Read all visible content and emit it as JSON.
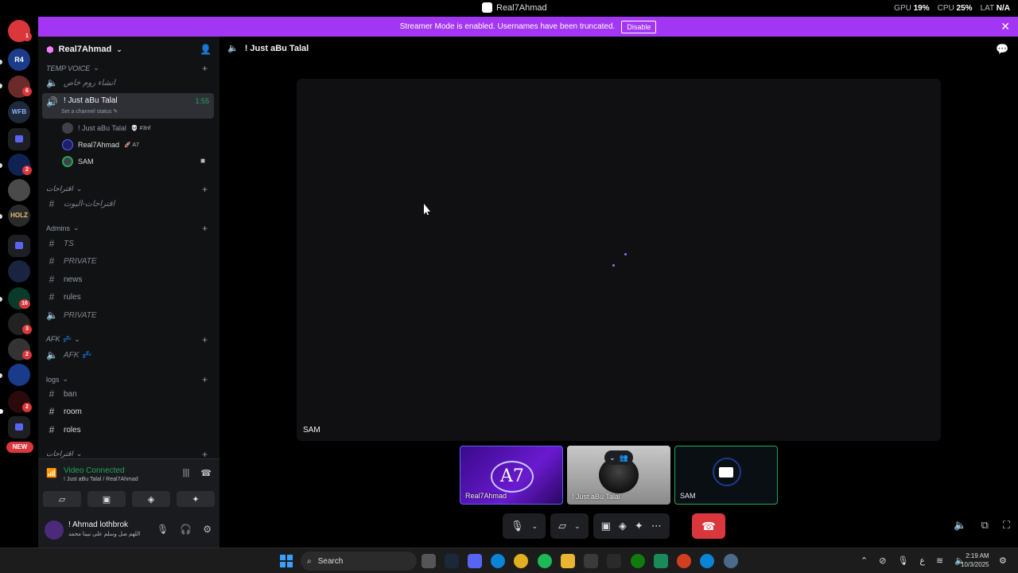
{
  "window": {
    "title": "Real7Ahmad"
  },
  "perf": {
    "gpu_label": "GPU",
    "gpu_value": "19%",
    "cpu_label": "CPU",
    "cpu_value": "25%",
    "lat_label": "LAT",
    "lat_value": "N/A"
  },
  "banner": {
    "text": "Streamer Mode is enabled. Usernames have been truncated.",
    "button": "Disable"
  },
  "rail": {
    "badges": [
      "1",
      "6",
      "2",
      "16",
      "3",
      "2",
      "2"
    ],
    "new_label": "NEW",
    "server_text": [
      "R4",
      "WFB",
      "HOLZ"
    ]
  },
  "server": {
    "name": "Real7Ahmad"
  },
  "sidebar": {
    "cat_temp": "TEMP VOICE",
    "ch_create_room": "انشاء روم خاص",
    "active_channel": {
      "name": "! Just aBu Talal",
      "timer": "1:55",
      "status": "Set a channel status"
    },
    "voice_users": [
      {
        "name": "! Just aBu Talal",
        "tag": "#3nf"
      },
      {
        "name": "Real7Ahmad",
        "tag": "A7"
      },
      {
        "name": "SAM",
        "tag": ""
      }
    ],
    "cat_suggest": "اقتراحات",
    "ch_suggest_bot": "اقتراحات-البوت",
    "cat_admins": "Admins",
    "ch_ts": "TS",
    "ch_private1": "PRIVATE",
    "ch_news": "news",
    "ch_rules": "rules",
    "ch_private2": "PRIVATE",
    "cat_afk": "AFK 💤",
    "ch_afk": "AFK 💤",
    "cat_logs": "logs",
    "ch_ban": "ban",
    "ch_room": "room",
    "ch_roles": "roles",
    "cat_suggest2": "اقتراحات"
  },
  "voice_panel": {
    "status": "Video Connected",
    "location": "! Just aBu Talal / Real7Ahmad"
  },
  "user_panel": {
    "name": "! Ahmad lothbrok",
    "status": "اللهم صل وسلم على نبينا محمد"
  },
  "main": {
    "channel_title": "! Just aBu Talal",
    "stage_label": "SAM",
    "tiles": [
      {
        "label": "Real7Ahmad",
        "logo": "A7"
      },
      {
        "label": "! Just aBu Talal"
      },
      {
        "label": "SAM"
      }
    ]
  },
  "taskbar": {
    "search_placeholder": "Search",
    "time": "2:19 AM",
    "date": "10/3/2025",
    "lang": "ع"
  },
  "colors": {
    "banner": "#a336f2",
    "connected": "#23a55a",
    "hangup": "#da373c",
    "badge": "#da373c"
  }
}
